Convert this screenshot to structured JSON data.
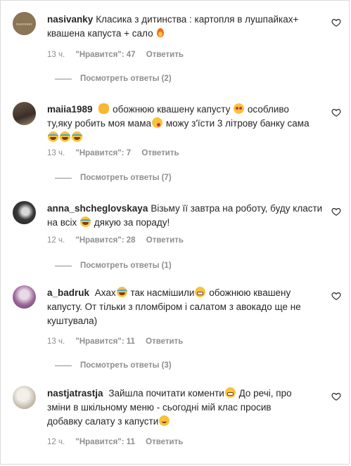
{
  "comments": [
    {
      "username": "nasivanky",
      "lines": [
        "Класика з дитинства : картопля в лушпайках+",
        "квашена капуста + сало"
      ],
      "time": "13 ч.",
      "likes": "\"Нравится\": 47",
      "reply": "Ответить",
      "replies": "Посмотреть ответы (2)"
    },
    {
      "username": "maiia1989",
      "seg1": "обожнюю квашену капусту",
      "seg2": "особливо",
      "seg3": "ту,яку робить моя мама",
      "seg4": "можу з'їсти 3 літрову банку сама",
      "time": "13 ч.",
      "likes": "\"Нравится\": 7",
      "reply": "Ответить",
      "replies": "Посмотреть ответы (7)"
    },
    {
      "username": "anna_shcheglovskaya",
      "seg1": "Візьму її завтра на роботу, буду класти",
      "seg2": "на всіх",
      "seg3": "дякую за пораду!",
      "time": "12 ч.",
      "likes": "\"Нравится\": 28",
      "reply": "Ответить",
      "replies": "Посмотреть ответы (1)"
    },
    {
      "username": "a_badruk",
      "seg1": "Ахах",
      "seg2": "так насмішили",
      "seg3": "обожнюю квашену",
      "seg4": "капусту. От тільки з пломбіром і салатом з авокадо ще не",
      "seg5": "куштувала)",
      "time": "13 ч.",
      "likes": "\"Нравится\": 11",
      "reply": "Ответить",
      "replies": "Посмотреть ответы (3)"
    },
    {
      "username": "nastjatrastja",
      "seg1": "Зайшла почитати коменти",
      "seg2": "До речі, про",
      "seg3": "зміни в шкільному меню - сьогодні мій клас просив",
      "seg4": "добавку салату з капусти",
      "time": "12 ч.",
      "likes": "\"Нравится\": 11",
      "reply": "Ответить"
    }
  ],
  "avatar_logo_text": "NASIVANKY",
  "icons": [
    "heart-outline-icon"
  ],
  "colors": {
    "text": "#262626",
    "meta": "#8e8e8e",
    "border": "#dbdbdb"
  }
}
